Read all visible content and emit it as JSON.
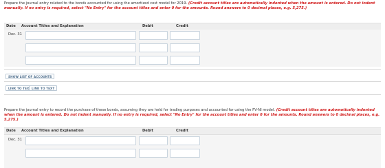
{
  "part1": {
    "instruction": "Prepare the journal entry related to the bonds accounted for using the amortized cost model for 2019.",
    "note": "(Credit account titles are automatically indented when the amount is entered. Do not indent manually. If no entry is required, select \"No Entry\" for the account titles and enter 0 for the amounts. Round answers to 0 decimal places, e.g. 5,275.)",
    "columns": {
      "date": "Date",
      "account": "Account Titles and Explanation",
      "debit": "Debit",
      "credit": "Credit"
    },
    "rows": [
      {
        "date": "Dec. 31",
        "account": "",
        "debit": "",
        "credit": ""
      },
      {
        "date": "",
        "account": "",
        "debit": "",
        "credit": ""
      },
      {
        "date": "",
        "account": "",
        "debit": "",
        "credit": ""
      }
    ],
    "buttons": {
      "show_list": "SHOW LIST OF ACCOUNTS",
      "link_to_text_1": "LINK TO TEXT",
      "link_to_text_2": "LINK TO TEXT"
    }
  },
  "part2": {
    "instruction": "Prepare the journal entry to record the purchase of these bonds, assuming they are held for trading purposes and accounted for using the FV-NI model.",
    "note": "(Credit account titles are automatically indented when the amount is entered. Do not indent manually. If no entry is required, select \"No Entry\" for the account titles and enter 0 for the amounts. Round answers to 0 decimal places, e.g. 5,275.)",
    "columns": {
      "date": "Date",
      "account": "Account Titles and Explanation",
      "debit": "Debit",
      "credit": "Credit"
    },
    "rows": [
      {
        "date": "Dec. 31",
        "account": "",
        "debit": "",
        "credit": ""
      },
      {
        "date": "",
        "account": "",
        "debit": "",
        "credit": ""
      }
    ]
  },
  "colors": {
    "note_red": "#d11a1a",
    "header_bg": "#eeeeee",
    "panel_bg": "#f5f5f5",
    "input_border": "#c9d4de",
    "button_text": "#4a6b8a"
  }
}
